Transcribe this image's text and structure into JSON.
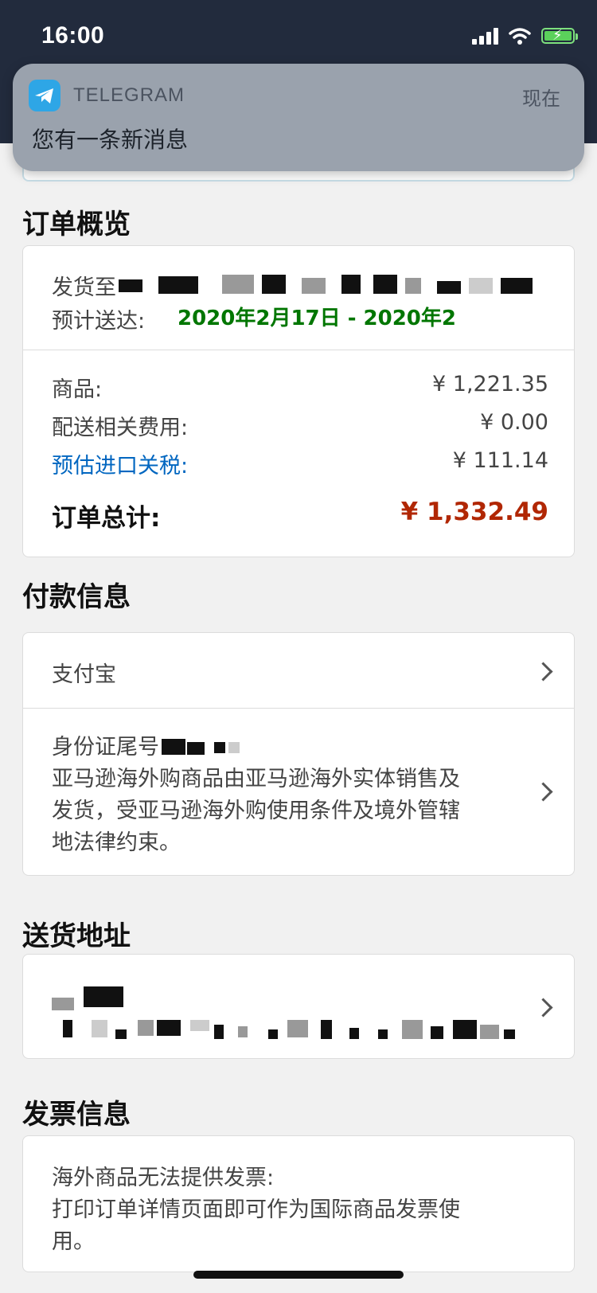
{
  "status": {
    "time": "16:00"
  },
  "notification": {
    "app": "TELEGRAM",
    "time": "现在",
    "message": "您有一条新消息"
  },
  "order_overview": {
    "title": "订单概览",
    "ship_to_label": "发货至",
    "delivery_label": "预计送达:",
    "delivery_value": "2020年2月17日 - 2020年2",
    "items_label": "商品:",
    "items_value": "¥ 1,221.35",
    "shipping_label": "配送相关费用:",
    "shipping_value": "¥ 0.00",
    "tax_label": "预估进口关税:",
    "tax_value": "¥ 111.14",
    "total_label": "订单总计:",
    "total_value": "¥ 1,332.49"
  },
  "payment": {
    "title": "付款信息",
    "method": "支付宝",
    "id_label": "身份证尾号",
    "notice_line1": "亚马逊海外购商品由亚马逊海外实体销售及",
    "notice_line2": "发货，受亚马逊海外购使用条件及境外管辖",
    "notice_line3": "地法律约束。"
  },
  "shipping_address": {
    "title": "送货地址"
  },
  "invoice": {
    "title": "发票信息",
    "line1": "海外商品无法提供发票:",
    "line2": "打印订单详情页面即可作为国际商品发票使",
    "line3": "用。"
  },
  "colors": {
    "total": "#b12704",
    "link": "#0066c0",
    "delivery": "#007600",
    "statusbar": "#222b3d"
  }
}
